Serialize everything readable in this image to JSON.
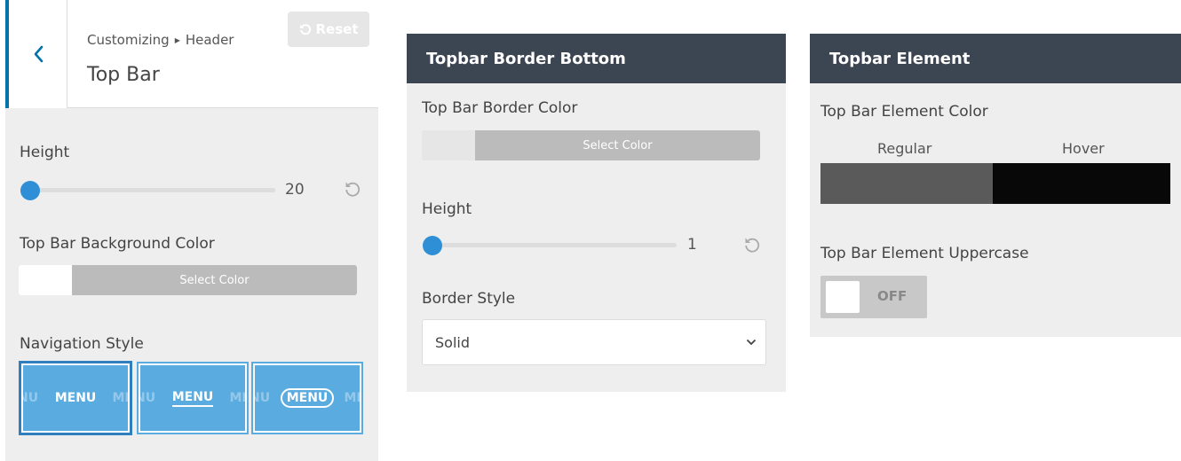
{
  "customizer": {
    "breadcrumb_parent": "Customizing",
    "breadcrumb_child": "Header",
    "section_title": "Top Bar",
    "reset_label": "Reset",
    "height_label": "Height",
    "height_value": "20",
    "bg_color_label": "Top Bar Background Color",
    "select_color_label": "Select Color",
    "nav_style_label": "Navigation Style",
    "nav_options": [
      {
        "ghost_left": "NU",
        "main": "MENU",
        "ghost_right": "ME"
      },
      {
        "ghost_left": "NU",
        "main": "MENU",
        "ghost_right": "ME"
      },
      {
        "ghost_left": "NU",
        "main": "MENU",
        "ghost_right": "ME"
      }
    ]
  },
  "border_panel": {
    "title": "Topbar Border Bottom",
    "border_color_label": "Top Bar Border Color",
    "select_color_label": "Select Color",
    "height_label": "Height",
    "height_value": "1",
    "border_style_label": "Border Style",
    "border_style_value": "Solid"
  },
  "element_panel": {
    "title": "Topbar Element",
    "element_color_label": "Top Bar Element Color",
    "regular_label": "Regular",
    "hover_label": "Hover",
    "regular_color": "#5a5a5a",
    "hover_color": "#080808",
    "uppercase_label": "Top Bar Element Uppercase",
    "toggle_state": "OFF"
  },
  "colors": {
    "accent": "#2f8fd6",
    "header_dark": "#3c4552",
    "nav_blue": "#5aabe0",
    "wp_blue": "#0073aa"
  },
  "icons": [
    "chevron-left-icon",
    "undo-icon",
    "chevron-down-icon",
    "triangle-right-icon"
  ]
}
